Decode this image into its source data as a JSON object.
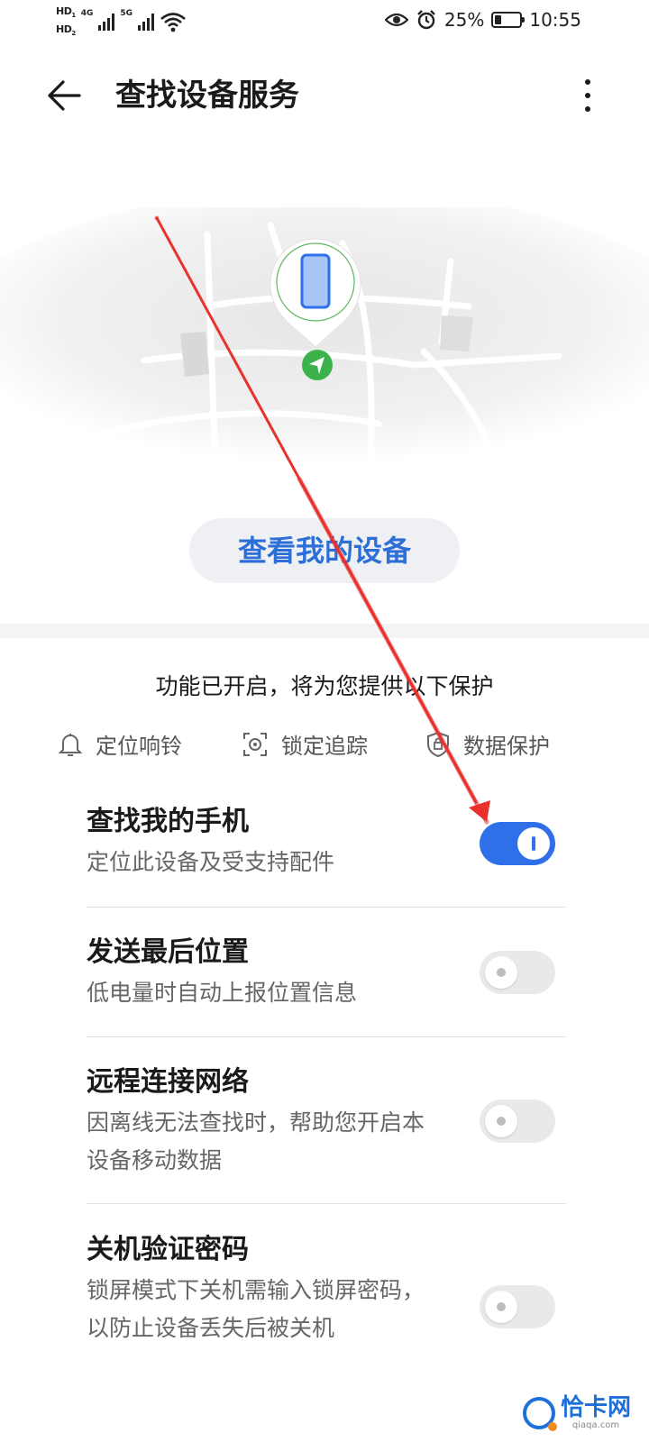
{
  "status_bar": {
    "hd1": "HD",
    "hd1_sub": "1",
    "hd2": "HD",
    "hd2_sub": "2",
    "net1": "4G",
    "net2": "5G",
    "battery_text": "25%",
    "battery_level": 0.25,
    "time": "10:55"
  },
  "app_bar": {
    "title": "查找设备服务"
  },
  "map": {
    "view_button_label": "查看我的设备"
  },
  "protection": {
    "title": "功能已开启，将为您提供以下保护",
    "features": [
      {
        "label": "定位响铃",
        "icon": "bell-icon"
      },
      {
        "label": "锁定追踪",
        "icon": "lock-target-icon"
      },
      {
        "label": "数据保护",
        "icon": "shield-icon"
      }
    ]
  },
  "settings": [
    {
      "title": "查找我的手机",
      "desc": "定位此设备及受支持配件",
      "enabled": true
    },
    {
      "title": "发送最后位置",
      "desc": "低电量时自动上报位置信息",
      "enabled": false
    },
    {
      "title": "远程连接网络",
      "desc": "因离线无法查找时，帮助您开启本设备移动数据",
      "enabled": false
    },
    {
      "title": "关机验证密码",
      "desc": "锁屏模式下关机需输入锁屏密码，以防止设备丢失后被关机",
      "enabled": false
    }
  ],
  "watermark": {
    "text": "恰卡网",
    "sub": "qiaqa.com"
  },
  "colors": {
    "accent": "#2f6fe8",
    "link_blue": "#2d6fd6",
    "location_green": "#3cb34a",
    "annotation_red": "#e8322b"
  }
}
